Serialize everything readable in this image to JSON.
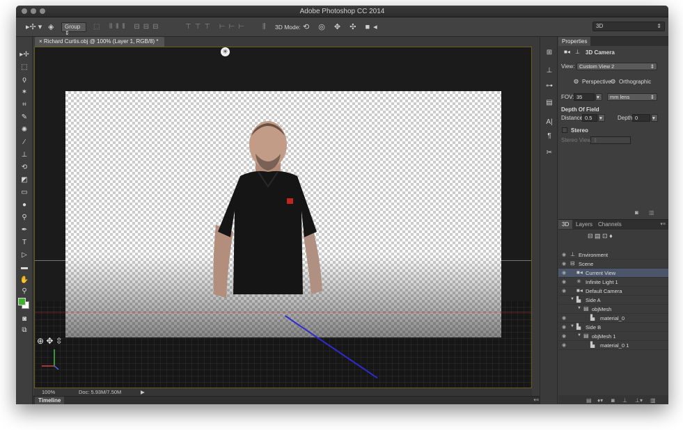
{
  "window": {
    "title": "Adobe Photoshop CC 2014"
  },
  "options_bar": {
    "group_select": "Group",
    "mode_label": "3D Mode:",
    "workspace": "3D"
  },
  "document": {
    "tab_title": "Richard Curtis.obj @ 100% (Layer 1, RGB/8) *",
    "zoom": "100%",
    "doc_size": "Doc: 5.93M/7.50M"
  },
  "timeline": {
    "label": "Timeline"
  },
  "colors": {
    "foreground": "#44b031",
    "background": "#ffffff",
    "selection": "#4b566a"
  },
  "properties": {
    "tab": "Properties",
    "header": "3D Camera",
    "view_label": "View:",
    "view_value": "Custom View 2",
    "perspective_label": "Perspective",
    "orthographic_label": "Orthographic",
    "fov_label": "FOV:",
    "fov_value": "35",
    "lens_value": "mm lens",
    "dof_title": "Depth Of Field",
    "distance_label": "Distance:",
    "distance_value": "0.5",
    "depth_label": "Depth:",
    "depth_value": "0",
    "stereo_label": "Stereo",
    "stereo_view_label": "Stereo View:"
  },
  "layers_panel": {
    "tabs": [
      "3D",
      "Layers",
      "Channels"
    ],
    "items": [
      {
        "label": "Environment",
        "icon": "environment-icon",
        "visible": true
      },
      {
        "label": "Scene",
        "icon": "scene-icon",
        "visible": true
      },
      {
        "label": "Current View",
        "icon": "camera-icon",
        "visible": true,
        "selected": true
      },
      {
        "label": "Infinite Light 1",
        "icon": "light-icon",
        "visible": true
      },
      {
        "label": "Default Camera",
        "icon": "camera-icon",
        "visible": true
      },
      {
        "label": "Side A",
        "icon": "mesh-group-icon",
        "visible": false
      },
      {
        "label": "objMesh",
        "icon": "mesh-icon",
        "visible": false
      },
      {
        "label": "material_0",
        "icon": "material-icon",
        "visible": true
      },
      {
        "label": "Side B",
        "icon": "mesh-group-icon",
        "visible": true
      },
      {
        "label": "objMesh 1",
        "icon": "mesh-icon",
        "visible": true
      },
      {
        "label": "material_0 1",
        "icon": "material-icon",
        "visible": true
      }
    ]
  }
}
